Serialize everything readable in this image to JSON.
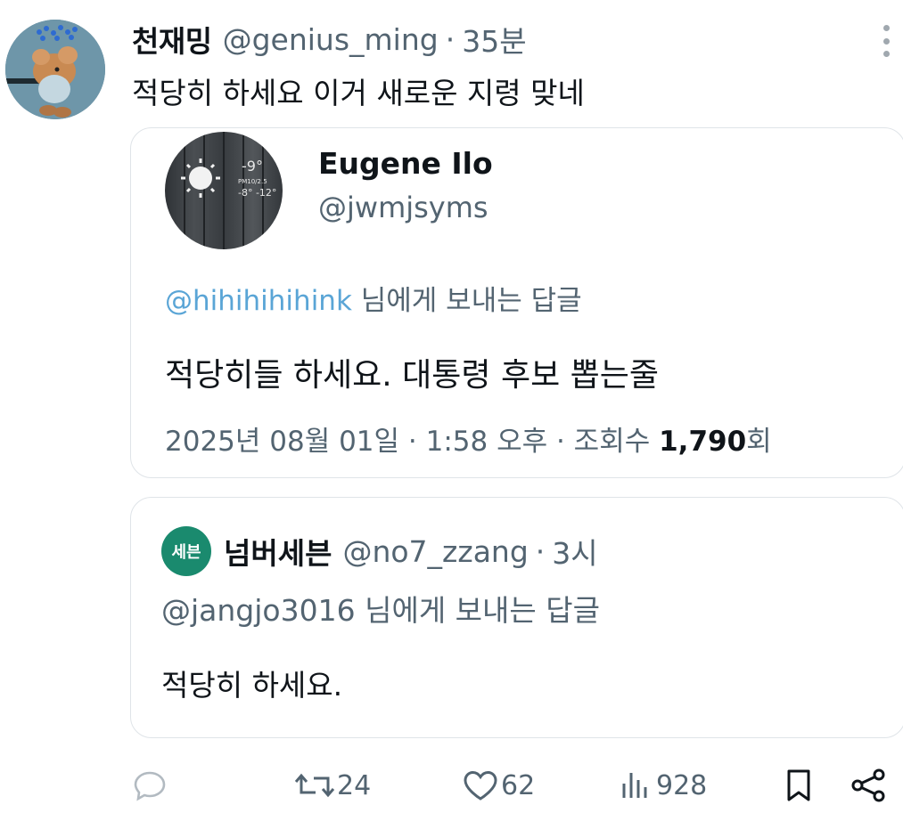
{
  "tweet": {
    "display_name": "천재밍",
    "handle": "@genius_ming",
    "separator": "·",
    "time": "35분",
    "text": "적당히 하세요 이거 새로운 지령 맞네"
  },
  "quote1": {
    "display_name": "Eugene Ilo",
    "handle": "@jwmjsyms",
    "reply_mention": "@hihihihihink",
    "reply_suffix": "님에게 보내는 답글",
    "text": "적당히들 하세요. 대통령 후보 뽑는줄",
    "date": "2025년 08월 01일 · 1:58 오후 · 조회수 ",
    "views": "1,790",
    "views_suffix": "회"
  },
  "quote2": {
    "avatar_text": "세븐",
    "display_name": "넘버세븐",
    "handle": "@no7_zzang",
    "separator": "·",
    "time": "3시",
    "reply_mention": "@jangjo3016",
    "reply_suffix": "님에게 보내는 답글",
    "text": "적당히 하세요."
  },
  "actions": {
    "reply_icon": "reply-icon",
    "retweets": "24",
    "likes": "62",
    "views": "928",
    "bookmark_icon": "bookmark-icon",
    "share_icon": "share-icon"
  },
  "colors": {
    "text": "#0f1419",
    "secondary": "#536471",
    "mention": "#5aa5d6",
    "border": "#dfe4e8",
    "seven_green": "#1a8a6e"
  }
}
